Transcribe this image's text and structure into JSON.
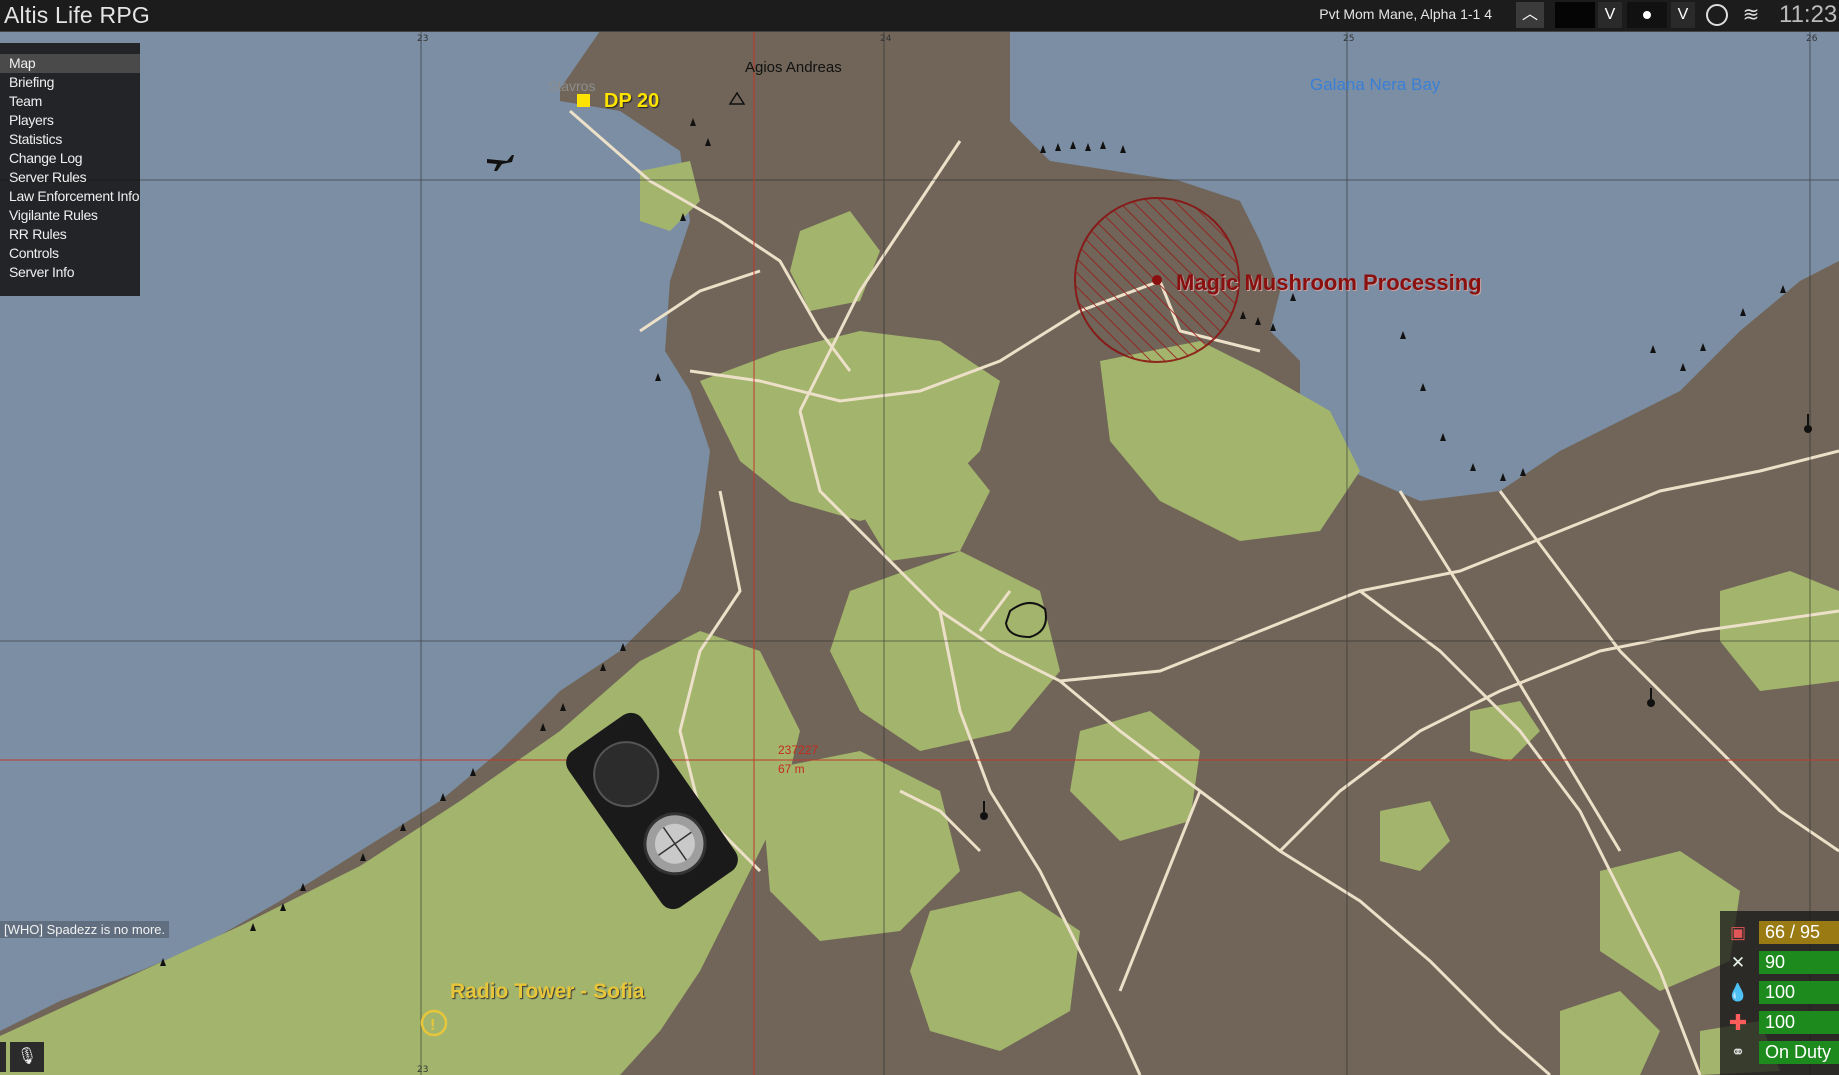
{
  "window": {
    "title": "Altis Life RPG"
  },
  "topbar": {
    "unit_label": "Pvt Mom Mane, Alpha 1-1 4",
    "clock": "11:23",
    "toggles": [
      "V",
      "V"
    ]
  },
  "menu": {
    "items": [
      {
        "label": "Map",
        "active": true
      },
      {
        "label": "Briefing"
      },
      {
        "label": "Team"
      },
      {
        "label": "Players"
      },
      {
        "label": "Statistics"
      },
      {
        "label": "Change Log"
      },
      {
        "label": "Server Rules"
      },
      {
        "label": "Law Enforcement Info"
      },
      {
        "label": "Vigilante Rules"
      },
      {
        "label": "RR Rules"
      },
      {
        "label": "Controls"
      },
      {
        "label": "Server Info"
      }
    ]
  },
  "map": {
    "grid_labels": [
      "23",
      "24",
      "25",
      "26"
    ],
    "locations": {
      "agios_andreas": "Agios Andreas",
      "galana_bay": "Galana Nera Bay",
      "stavros": "Stavros"
    },
    "markers": {
      "dp20": "DP 20",
      "mushroom": "Magic Mushroom Processing",
      "radio_tower": "Radio Tower - Sofia"
    },
    "cursor": {
      "grid": "237227",
      "distance": "67 m"
    },
    "colors": {
      "water": "#7b8ea3",
      "land": "#706558",
      "vegetation": "#a3b46d",
      "road": "#ece0c8",
      "marker_red": "#8a0f0f",
      "marker_yellow": "#ffe300",
      "radio_text": "#e8c63a",
      "bay_text": "#3a7fd6"
    }
  },
  "chat": {
    "message": "[WHO] Spadezz is no more."
  },
  "hud": {
    "cash": "66 / 95",
    "food": "90",
    "water": "100",
    "health": "100",
    "status": "On Duty"
  }
}
